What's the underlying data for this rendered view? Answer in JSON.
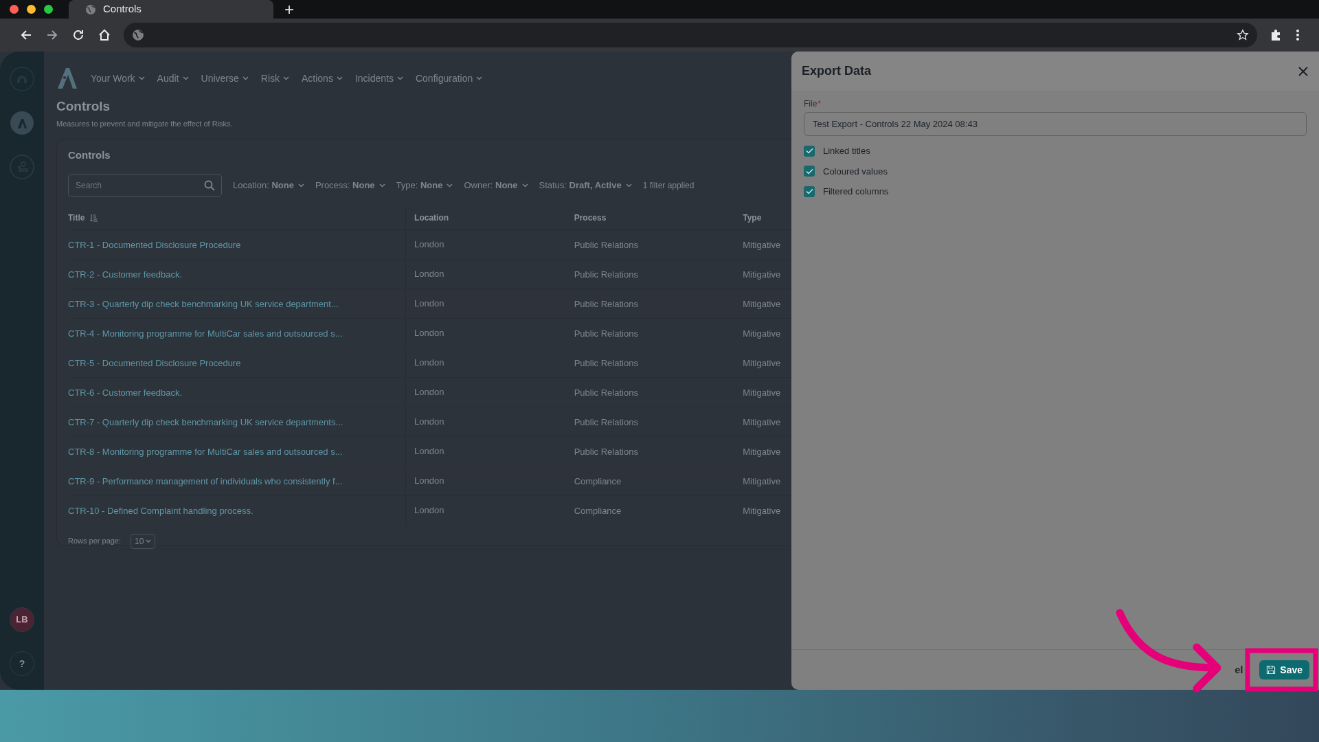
{
  "browser": {
    "tab_title": "Controls",
    "new_tab": "+"
  },
  "nav": {
    "items": [
      "Your Work",
      "Audit",
      "Universe",
      "Risk",
      "Actions",
      "Incidents",
      "Configuration"
    ]
  },
  "sidebar": {
    "avatar": "LB",
    "help": "?"
  },
  "page": {
    "title": "Controls",
    "subtitle": "Measures to prevent and mitigate the effect of Risks.",
    "card_title": "Controls"
  },
  "search": {
    "placeholder": "Search"
  },
  "filters": [
    {
      "label": "Location:",
      "value": "None"
    },
    {
      "label": "Process:",
      "value": "None"
    },
    {
      "label": "Type:",
      "value": "None"
    },
    {
      "label": "Owner:",
      "value": "None"
    },
    {
      "label": "Status:",
      "value": "Draft, Active"
    }
  ],
  "filter_count": "1 filter applied",
  "table": {
    "columns": [
      "Title",
      "Location",
      "Process",
      "Type"
    ],
    "rows": [
      [
        "CTR-1 - Documented Disclosure Procedure",
        "London",
        "Public Relations",
        "Mitigative"
      ],
      [
        "CTR-2 - Customer feedback.",
        "London",
        "Public Relations",
        "Mitigative"
      ],
      [
        "CTR-3 - Quarterly dip check benchmarking UK service department...",
        "London",
        "Public Relations",
        "Mitigative"
      ],
      [
        "CTR-4 - Monitoring programme for MultiCar sales and outsourced s...",
        "London",
        "Public Relations",
        "Mitigative"
      ],
      [
        "CTR-5 - Documented Disclosure Procedure",
        "London",
        "Public Relations",
        "Mitigative"
      ],
      [
        "CTR-6 - Customer feedback.",
        "London",
        "Public Relations",
        "Mitigative"
      ],
      [
        "CTR-7 - Quarterly dip check benchmarking UK service departments...",
        "London",
        "Public Relations",
        "Mitigative"
      ],
      [
        "CTR-8 - Monitoring programme for MultiCar sales and outsourced s...",
        "London",
        "Public Relations",
        "Mitigative"
      ],
      [
        "CTR-9 - Performance management of individuals who consistently f...",
        "London",
        "Compliance",
        "Mitigative"
      ],
      [
        "CTR-10 - Defined Complaint handling process.",
        "London",
        "Compliance",
        "Mitigative"
      ]
    ]
  },
  "pagination": {
    "label": "Rows per page:",
    "value": "10"
  },
  "export_panel": {
    "title": "Export Data",
    "file_label": "File",
    "required_mark": "*",
    "file_value": "Test Export - Controls 22 May 2024 08:43",
    "options": [
      {
        "label": "Linked titles",
        "checked": true
      },
      {
        "label": "Coloured values",
        "checked": true
      },
      {
        "label": "Filtered columns",
        "checked": true
      }
    ],
    "cancel_button": "el",
    "save_button": "Save"
  }
}
